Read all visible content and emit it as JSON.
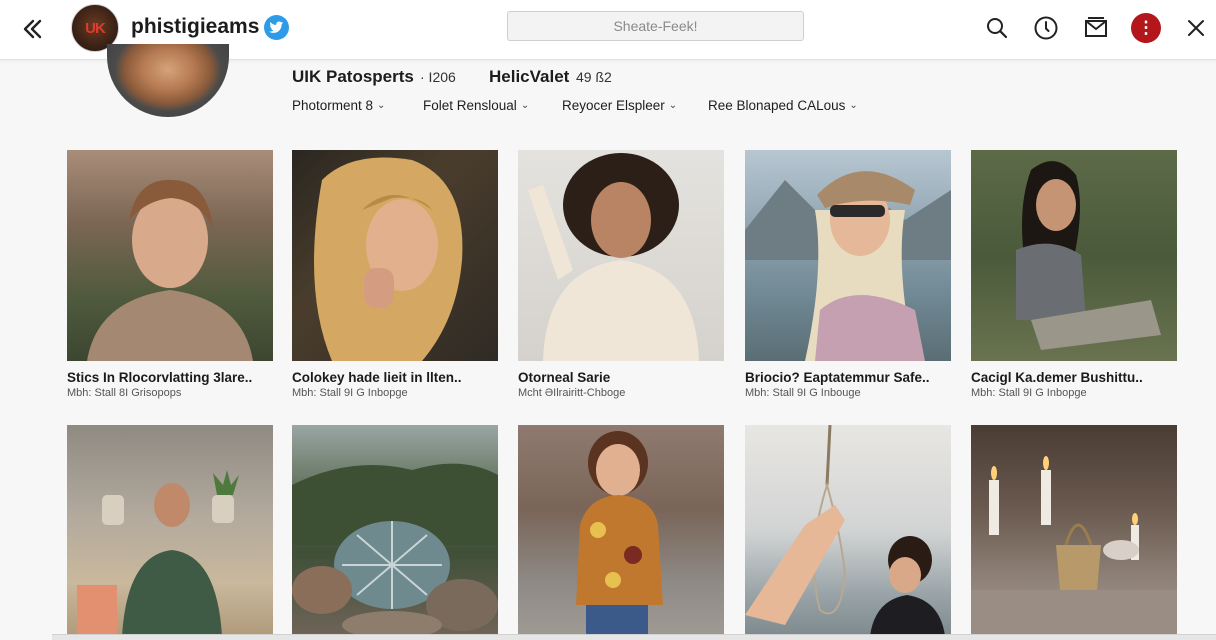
{
  "topbar": {
    "account_name": "phistigieams",
    "logo_text": "UK",
    "search_placeholder": "Sheate-Feek!",
    "icons": [
      "back-chevrons-icon",
      "verified-badge-icon",
      "search-icon",
      "clock-icon",
      "inbox-icon",
      "alert-icon",
      "close-icon"
    ],
    "alert_color": "#b3161b",
    "verified_color": "#2d9be8"
  },
  "profile": {
    "name": "UIK Patosperts",
    "count": "· I206",
    "stat_label": "HelicValet",
    "stat_value": "49 ß2"
  },
  "filters": [
    {
      "label": "Photorment 8"
    },
    {
      "label": "Folet Rensloual"
    },
    {
      "label": "Reyocer Elspleer"
    },
    {
      "label": "Ree Blonaped CALous"
    }
  ],
  "photos": [
    {
      "title": "Stics In Rlocorvlatting 3lare..",
      "meta": "Mbh: Stall 8I Grisopops"
    },
    {
      "title": "Colokey hade lieit in llten..",
      "meta": "Mbh: Stall 9I G Inbopge"
    },
    {
      "title": "Otorneal Sarie",
      "meta": "Mcht ƏIlrairitt-Chboge"
    },
    {
      "title": "Briocio? Eaptatemmur Safe..",
      "meta": "Mbh: Stall 9I G Inbouge"
    },
    {
      "title": "Cacigl Ka.demer Bushittu..",
      "meta": "Mbh: Stall 9I G Inbopge"
    },
    {
      "title": "",
      "meta": ""
    },
    {
      "title": "",
      "meta": ""
    },
    {
      "title": "",
      "meta": ""
    },
    {
      "title": "",
      "meta": ""
    },
    {
      "title": "",
      "meta": ""
    }
  ]
}
